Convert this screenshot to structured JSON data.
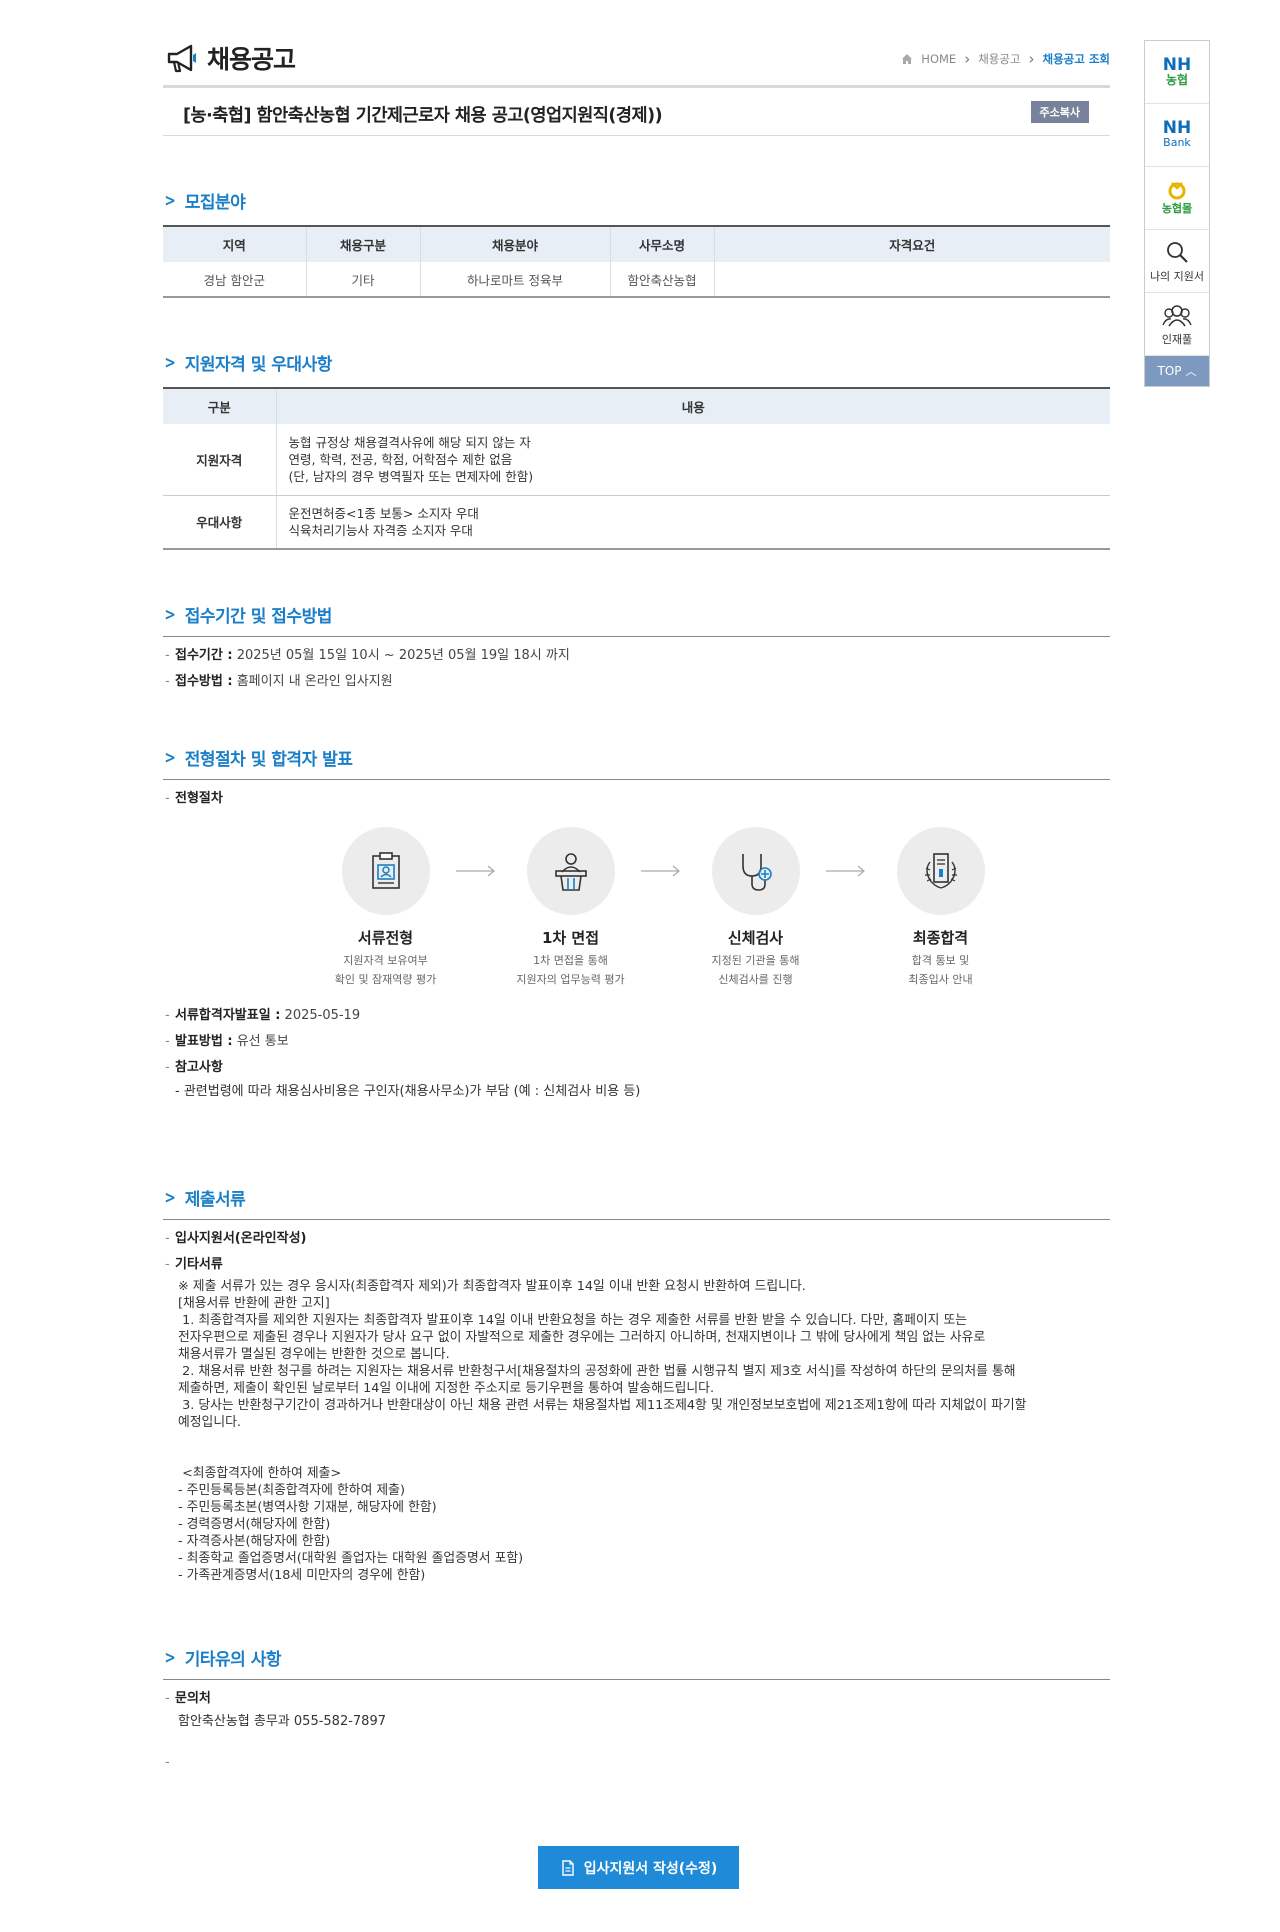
{
  "header": {
    "title": "채용공고",
    "breadcrumb": [
      "HOME",
      "채용공고",
      "채용공고 조회"
    ]
  },
  "notice": {
    "title": "[농·축협] 함안축산농협 기간제근로자 채용 공고(영업지원직(경제))",
    "copy_label": "주소복사"
  },
  "recruit": {
    "heading": "모집분야",
    "columns": [
      "지역",
      "채용구분",
      "채용분야",
      "사무소명",
      "자격요건"
    ],
    "rows": [
      [
        "경남 함안군",
        "기타",
        "하나로마트 정육부",
        "함안축산농협",
        ""
      ]
    ]
  },
  "qualification": {
    "heading": "지원자격 및 우대사항",
    "columns": [
      "구분",
      "내용"
    ],
    "rows": [
      {
        "label": "지원자격",
        "lines": [
          "농협 규정상 채용결격사유에 해당 되지 않는 자",
          "연령, 학력, 전공, 학점, 어학점수 제한 없음",
          "(단, 남자의 경우 병역필자 또는 면제자에 한함)"
        ]
      },
      {
        "label": "우대사항",
        "lines": [
          "운전면허증<1종 보통> 소지자 우대",
          "식육처리기능사 자격증 소지자 우대"
        ]
      }
    ]
  },
  "reception": {
    "heading": "접수기간 및 접수방법",
    "period_label": "접수기간 :",
    "period_value": "2025년 05월 15일 10시 ~ 2025년 05월 19일 18시 까지",
    "method_label": "접수방법 :",
    "method_value": "홈페이지 내 온라인 입사지원"
  },
  "process": {
    "heading": "전형절차 및 합격자 발표",
    "sub_label": "전형절차",
    "steps": [
      {
        "name": "서류전형",
        "desc1": "지원자격 보유여부",
        "desc2": "확인 및 잠재역량 평가",
        "icon": "document-clipboard-icon"
      },
      {
        "name": "1차 면접",
        "desc1": "1차 면접을 통해",
        "desc2": "지원자의 업무능력 평가",
        "icon": "interview-podium-icon"
      },
      {
        "name": "신체검사",
        "desc1": "지정된 기관을 통해",
        "desc2": "신체검사를 진행",
        "icon": "stethoscope-icon"
      },
      {
        "name": "최종합격",
        "desc1": "합격 통보 및",
        "desc2": "최종입사 안내",
        "icon": "laurel-certificate-icon"
      }
    ],
    "announce_label": "서류합격자발표일 :",
    "announce_value": "2025-05-19",
    "announce_method_label": "발표방법 :",
    "announce_method_value": "유선 통보",
    "note_label": "참고사항",
    "note_value": "- 관련법령에 따라 채용심사비용은 구인자(채용사무소)가 부담 (예 : 신체검사 비용 등)"
  },
  "documents": {
    "heading": "제출서류",
    "item1": "입사지원서(온라인작성)",
    "item2": "기타서류",
    "lines": [
      "※ 제출 서류가 있는 경우 응시자(최종합격자 제외)가 최종합격자 발표이후 14일 이내 반환 요청시 반환하여 드립니다.",
      "[채용서류 반환에 관한 고지]",
      " 1. 최종합격자를 제외한 지원자는 최종합격자 발표이후 14일 이내 반환요청을 하는 경우 제출한 서류를 반환 받을 수 있습니다. 다만, 홈페이지 또는",
      "전자우편으로 제출된 경우나 지원자가 당사 요구 없이 자발적으로 제출한 경우에는 그러하지 아니하며, 천재지변이나 그 밖에 당사에게 책임 없는 사유로",
      "채용서류가 멸실된 경우에는 반환한 것으로 봅니다.",
      " 2. 채용서류 반환 청구를 하려는 지원자는 채용서류 반환청구서[채용절차의 공정화에 관한 법률 시행규칙 별지 제3호 서식]를 작성하여 하단의 문의처를 통해",
      "제출하면, 제출이 확인된 날로부터 14일 이내에 지정한 주소지로 등기우편을 통하여 발송해드립니다.",
      " 3. 당사는 반환청구기간이 경과하거나 반환대상이 아닌 채용 관련 서류는 채용절차법 제11조제4항 및 개인정보보호법에 제21조제1항에 따라 지체없이 파기할",
      "예정입니다.",
      "",
      "",
      " <최종합격자에 한하여 제출>",
      "- 주민등록등본(최종합격자에 한하여 제출)",
      "- 주민등록초본(병역사항 기재분, 해당자에 한함)",
      "- 경력증명서(해당자에 한함)",
      "- 자격증사본(해당자에 한함)",
      "- 최종학교 졸업증명서(대학원 졸업자는 대학원 졸업증명서 포함)",
      "- 가족관계증명서(18세 미만자의 경우에 한함)"
    ]
  },
  "etc": {
    "heading": "기타유의 사항",
    "contact_label": "문의처",
    "contact_value": "함안축산농협 총무과 055-582-7897"
  },
  "apply_button": "입사지원서 작성(수정)",
  "quick": {
    "nh_line1": "NH",
    "nh_line2": "농협",
    "bank_line1": "NH",
    "bank_line2": "Bank",
    "mall_label": "농협몰",
    "my_apply": "나의 지원서",
    "talent": "인재풀",
    "top": "TOP"
  },
  "colors": {
    "accent": "#1a7fc8",
    "button": "#1f8ad8",
    "table_head": "#e7eef6",
    "top_btn": "#7e99c0"
  }
}
